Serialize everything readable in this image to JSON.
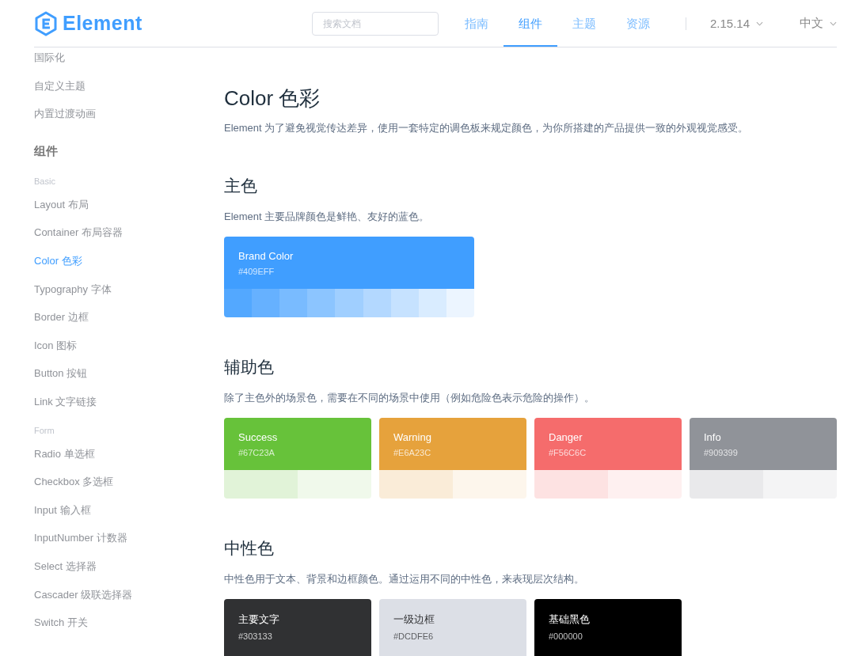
{
  "header": {
    "logo": "Element",
    "search": {
      "placeholder": "搜索文档"
    },
    "nav": [
      {
        "label": "指南",
        "selected": false
      },
      {
        "label": "组件",
        "selected": true
      },
      {
        "label": "主题",
        "selected": false
      },
      {
        "label": "资源",
        "selected": false
      }
    ],
    "version": "2.15.14",
    "language": "中文"
  },
  "sidebar": {
    "items": [
      {
        "kind": "link",
        "label": "国际化",
        "selected": false
      },
      {
        "kind": "link",
        "label": "自定义主题",
        "selected": false
      },
      {
        "kind": "link",
        "label": "内置过渡动画",
        "selected": false
      },
      {
        "kind": "group",
        "label": "组件"
      },
      {
        "kind": "category",
        "label": "Basic"
      },
      {
        "kind": "link",
        "label": "Layout 布局",
        "selected": false
      },
      {
        "kind": "link",
        "label": "Container 布局容器",
        "selected": false
      },
      {
        "kind": "link",
        "label": "Color 色彩",
        "selected": true
      },
      {
        "kind": "link",
        "label": "Typography 字体",
        "selected": false
      },
      {
        "kind": "link",
        "label": "Border 边框",
        "selected": false
      },
      {
        "kind": "link",
        "label": "Icon 图标",
        "selected": false
      },
      {
        "kind": "link",
        "label": "Button 按钮",
        "selected": false
      },
      {
        "kind": "link",
        "label": "Link 文字链接",
        "selected": false
      },
      {
        "kind": "category",
        "label": "Form"
      },
      {
        "kind": "link",
        "label": "Radio 单选框",
        "selected": false
      },
      {
        "kind": "link",
        "label": "Checkbox 多选框",
        "selected": false
      },
      {
        "kind": "link",
        "label": "Input 输入框",
        "selected": false
      },
      {
        "kind": "link",
        "label": "InputNumber 计数器",
        "selected": false
      },
      {
        "kind": "link",
        "label": "Select 选择器",
        "selected": false
      },
      {
        "kind": "link",
        "label": "Cascader 级联选择器",
        "selected": false
      },
      {
        "kind": "link",
        "label": "Switch 开关",
        "selected": false
      }
    ]
  },
  "content": {
    "title": "Color 色彩",
    "description": "Element 为了避免视觉传达差异，使用一套特定的调色板来规定颜色，为你所搭建的产品提供一致的外观视觉感受。",
    "sections": [
      {
        "kind": "brand",
        "heading": "主色",
        "description": "Element 主要品牌颜色是鲜艳、友好的蓝色。",
        "cards": [
          {
            "name": "Brand Color",
            "hex": "#409EFF",
            "color": "#409eff",
            "shades": [
              {
                "color": "#53a8ff"
              },
              {
                "color": "#66b1ff"
              },
              {
                "color": "#79bbff"
              },
              {
                "color": "#8cc5ff"
              },
              {
                "color": "#a0cfff"
              },
              {
                "color": "#b3d8ff"
              },
              {
                "color": "#c6e2ff"
              },
              {
                "color": "#d9ecff"
              },
              {
                "color": "#ecf5ff"
              }
            ]
          }
        ]
      },
      {
        "kind": "secondary",
        "heading": "辅助色",
        "description": "除了主色外的场景色，需要在不同的场景中使用（例如危险色表示危险的操作）。",
        "cards": [
          {
            "name": "Success",
            "hex": "#67C23A",
            "color": "#67c23a",
            "shades": [
              {
                "color": "#e1f3d8"
              },
              {
                "color": "#f0f9eb"
              }
            ]
          },
          {
            "name": "Warning",
            "hex": "#E6A23C",
            "color": "#e6a23c",
            "shades": [
              {
                "color": "#faecd8"
              },
              {
                "color": "#fdf6ec"
              }
            ]
          },
          {
            "name": "Danger",
            "hex": "#F56C6C",
            "color": "#f56c6c",
            "shades": [
              {
                "color": "#fde2e2"
              },
              {
                "color": "#fef0f0"
              }
            ]
          },
          {
            "name": "Info",
            "hex": "#909399",
            "color": "#909399",
            "shades": [
              {
                "color": "#e9e9eb"
              },
              {
                "color": "#f4f4f5"
              }
            ]
          }
        ]
      },
      {
        "kind": "neutral",
        "heading": "中性色",
        "description": "中性色用于文本、背景和边框颜色。通过运用不同的中性色，来表现层次结构。",
        "cards": [
          {
            "name": "主要文字",
            "hex": "#303133",
            "color": "#303133"
          },
          {
            "name": "一级边框",
            "hex": "#DCDFE6",
            "color": "#dcdfe6"
          },
          {
            "name": "基础黑色",
            "hex": "#000000",
            "color": "#000000"
          }
        ]
      }
    ]
  }
}
